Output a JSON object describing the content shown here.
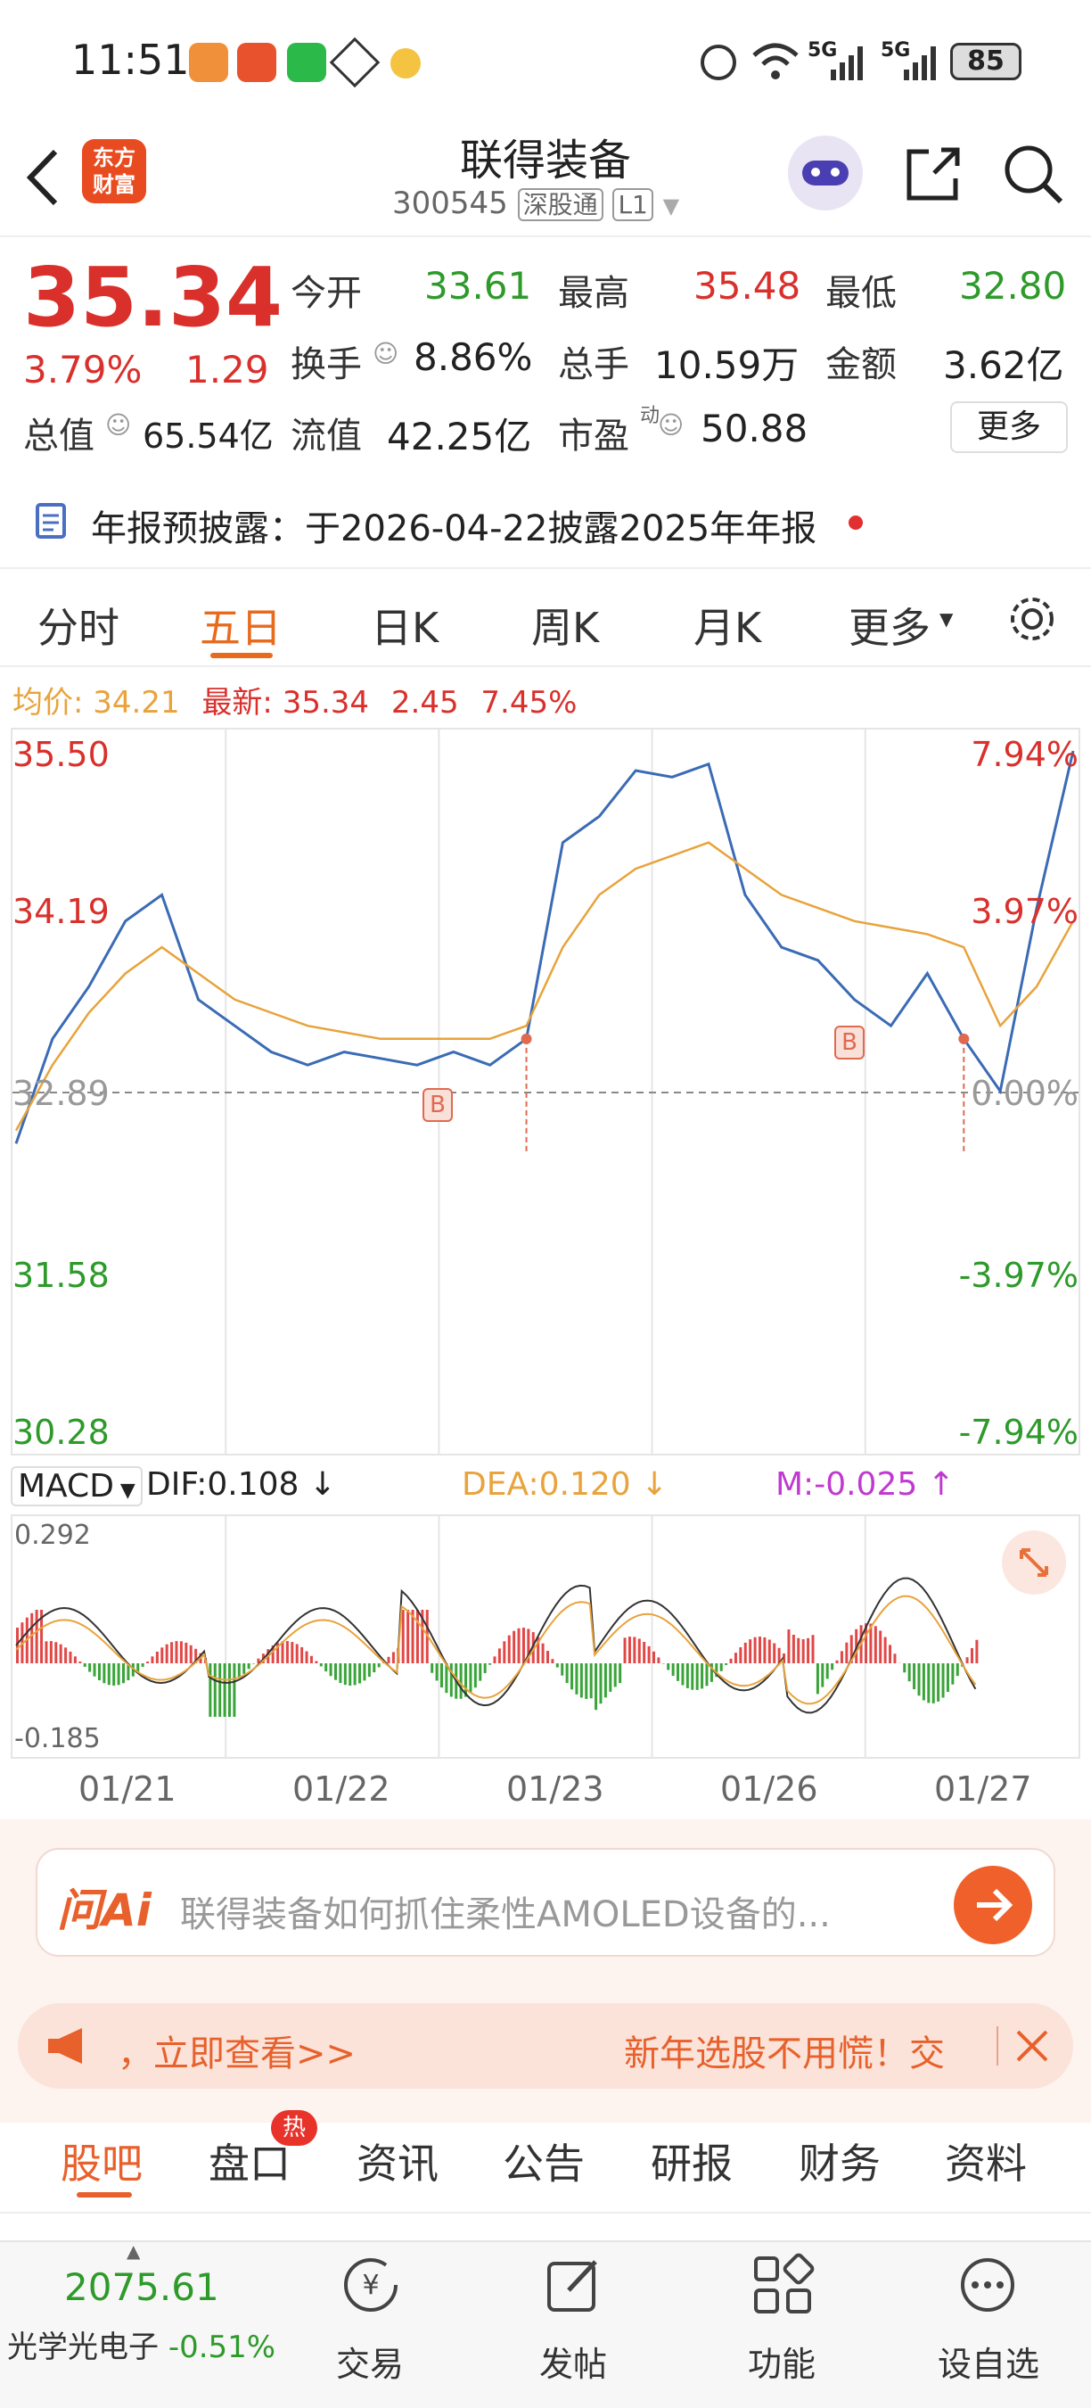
{
  "status": {
    "time": "11:51",
    "battery": "85",
    "signal1": "5G",
    "signal2": "5G"
  },
  "header": {
    "title": "联得装备",
    "code": "300545",
    "badge1": "深股通",
    "badge2": "L1",
    "logo_line1": "东方",
    "logo_line2": "财富"
  },
  "quote": {
    "price": "35.34",
    "change_pct": "3.79%",
    "change": "1.29",
    "open_label": "今开",
    "open": "33.61",
    "high_label": "最高",
    "high": "35.48",
    "low_label": "最低",
    "low": "32.80",
    "turnover_label": "换手",
    "turnover": "8.86%",
    "volume_label": "总手",
    "volume": "10.59万",
    "amount_label": "金额",
    "amount": "3.62亿",
    "mktcap_label": "总值",
    "mktcap": "65.54亿",
    "float_label": "流值",
    "float": "42.25亿",
    "pe_label": "市盈",
    "pe_sup": "动",
    "pe": "50.88",
    "more": "更多"
  },
  "notice": {
    "text": "年报预披露：于2026-04-22披露2025年年报"
  },
  "tabs": [
    "分时",
    "五日",
    "日K",
    "周K",
    "月K",
    "更多"
  ],
  "chart_info": {
    "avg_label": "均价:",
    "avg": "34.21",
    "latest_label": "最新:",
    "latest": "35.34",
    "chg": "2.45",
    "chg_pct": "7.45%"
  },
  "chart_data": {
    "type": "line",
    "x": [
      "01/21",
      "01/22",
      "01/23",
      "01/26",
      "01/27"
    ],
    "y_left_ticks": [
      "35.50",
      "34.19",
      "32.89",
      "31.58",
      "30.28"
    ],
    "y_right_ticks": [
      "7.94%",
      "3.97%",
      "0.00%",
      "-3.97%",
      "-7.94%"
    ],
    "ylim": [
      30.28,
      35.5
    ],
    "prev_close": 32.89,
    "series": [
      {
        "name": "",
        "color": "#3a6bb5",
        "values": [
          32.5,
          33.3,
          33.7,
          34.2,
          34.4,
          33.6,
          33.4,
          33.2,
          33.1,
          33.2,
          33.15,
          33.1,
          33.2,
          33.1,
          33.3,
          34.8,
          35.0,
          35.35,
          35.3,
          35.4,
          34.4,
          34.0,
          33.9,
          33.6,
          33.4,
          33.8,
          33.3,
          32.9,
          34.3,
          35.5
        ]
      },
      {
        "name": "",
        "color": "#e8a33c",
        "values": [
          32.6,
          33.1,
          33.5,
          33.8,
          34.0,
          33.8,
          33.6,
          33.5,
          33.4,
          33.35,
          33.3,
          33.3,
          33.3,
          33.3,
          33.4,
          34.0,
          34.4,
          34.6,
          34.7,
          34.8,
          34.6,
          34.4,
          34.3,
          34.2,
          34.15,
          34.1,
          34.0,
          33.4,
          33.7,
          34.2
        ]
      }
    ],
    "markers": [
      {
        "label": "B"
      },
      {
        "label": "B"
      }
    ]
  },
  "macd": {
    "name": "MACD",
    "dif_label": "DIF:",
    "dif": "0.108",
    "dea_label": "DEA:",
    "dea": "0.120",
    "m_label": "M:",
    "m": "-0.025",
    "ymax": "0.292",
    "ymin": "-0.185"
  },
  "ask_ai": {
    "label": "问Ai",
    "placeholder": "联得装备如何抓住柔性AMOLED设备的..."
  },
  "banner": {
    "left": "，立即查看>>",
    "right": "新年选股不用慌！交"
  },
  "bottom_tabs": [
    "股吧",
    "盘口",
    "资讯",
    "公告",
    "研报",
    "财务",
    "资料"
  ],
  "hot_badge": "热",
  "bottom_nav": {
    "index_value": "2075.61",
    "index_name": "光学光电子",
    "index_change": "-0.51%",
    "items": [
      "交易",
      "发帖",
      "功能",
      "设自选"
    ]
  }
}
